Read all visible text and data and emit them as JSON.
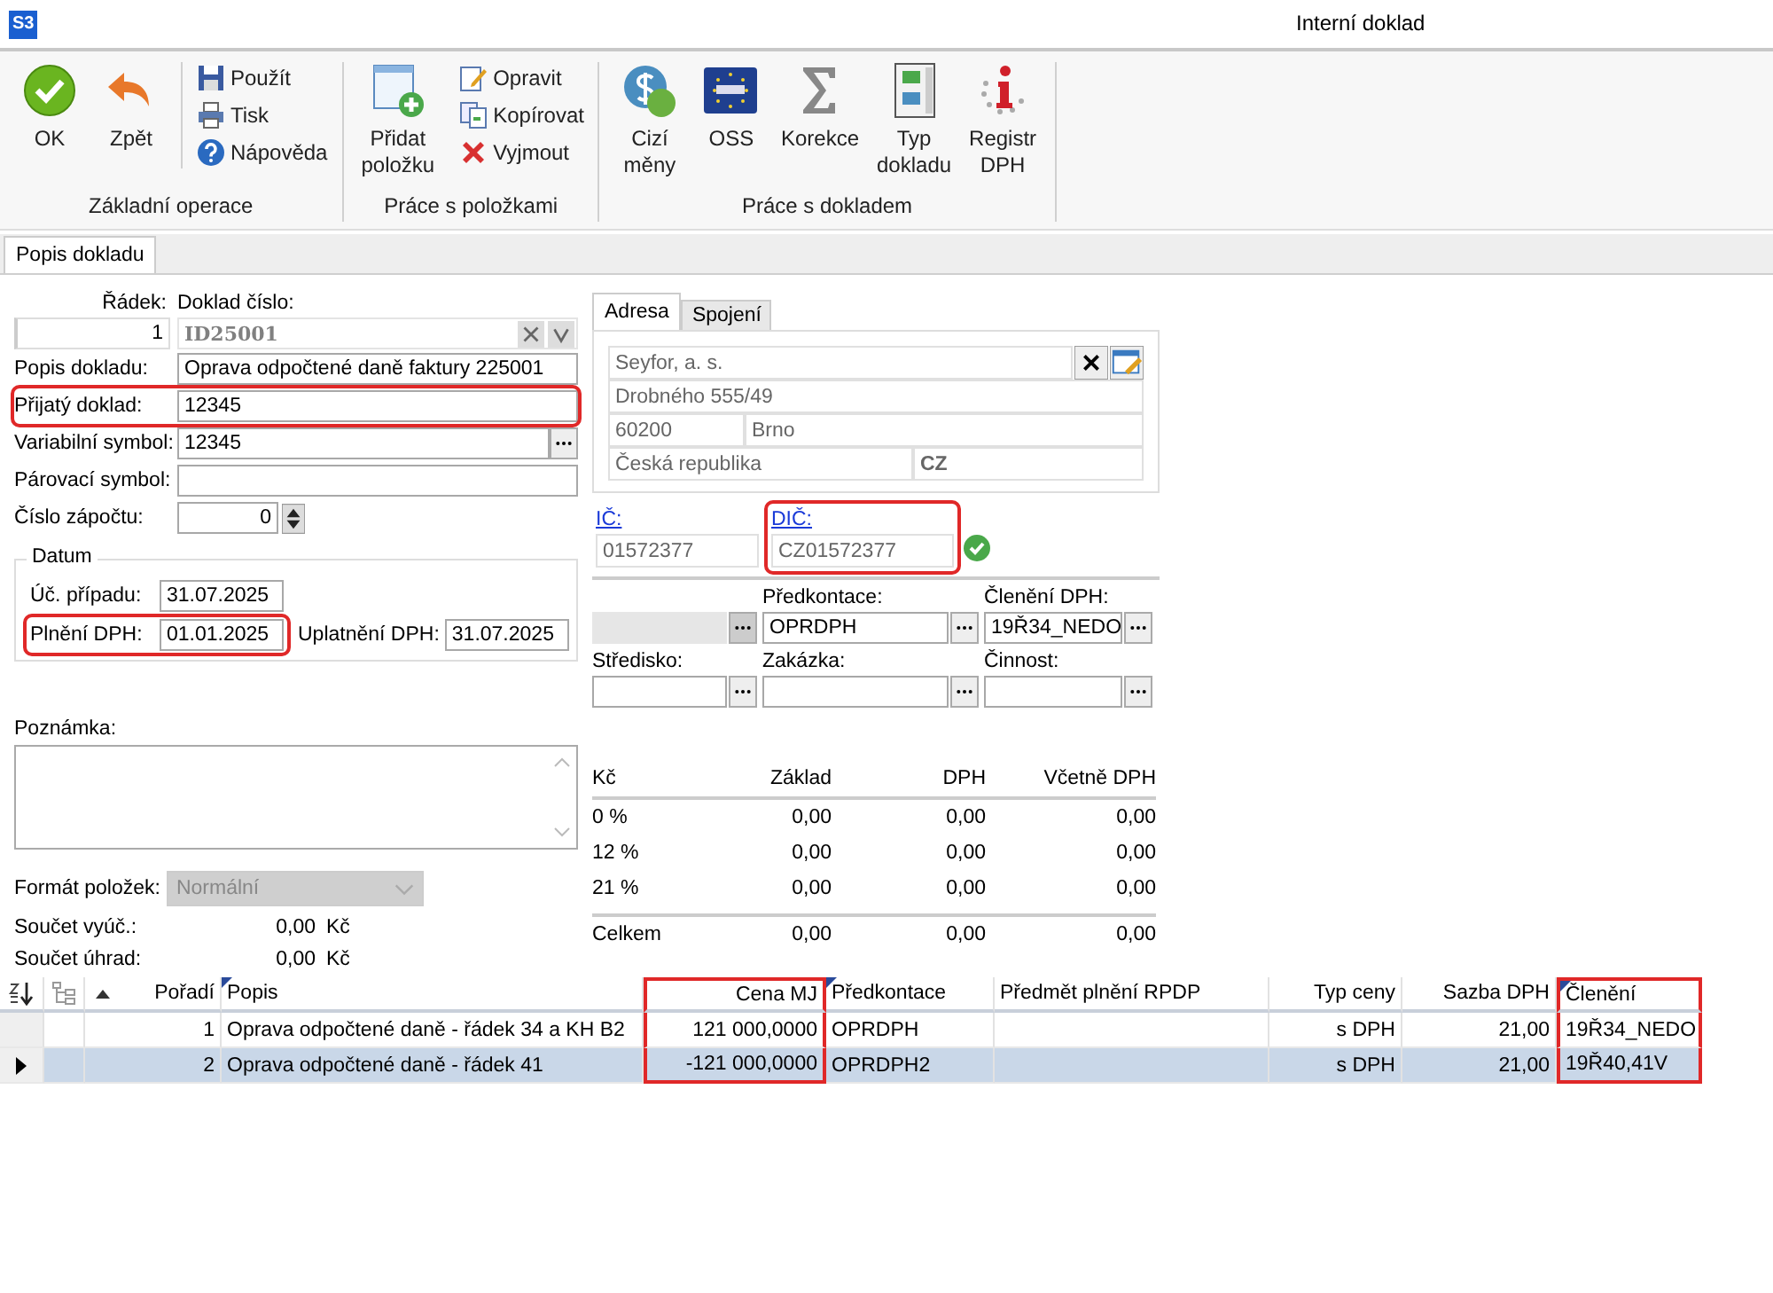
{
  "window": {
    "logo": "S3",
    "title": "Interní doklad"
  },
  "ribbon": {
    "groups": [
      {
        "label": "Základní operace",
        "large": [
          {
            "lines": [
              "OK"
            ]
          },
          {
            "lines": [
              "Zpět"
            ]
          }
        ],
        "small": [
          {
            "label": "Použít"
          },
          {
            "label": "Tisk"
          },
          {
            "label": "Nápověda"
          }
        ]
      },
      {
        "label": "Práce s položkami",
        "large": [
          {
            "lines": [
              "Přidat",
              "položku"
            ]
          }
        ],
        "small": [
          {
            "label": "Opravit"
          },
          {
            "label": "Kopírovat"
          },
          {
            "label": "Vyjmout"
          }
        ]
      },
      {
        "label": "Práce s dokladem",
        "large": [
          {
            "lines": [
              "Cizí",
              "měny"
            ]
          },
          {
            "lines": [
              "OSS"
            ]
          },
          {
            "lines": [
              "Korekce"
            ]
          },
          {
            "lines": [
              "Typ",
              "dokladu"
            ]
          },
          {
            "lines": [
              "Registr",
              "DPH"
            ]
          }
        ]
      }
    ]
  },
  "tabs": [
    {
      "label": "Popis dokladu",
      "selected": true
    }
  ],
  "doc": {
    "row_label": "Řádek:",
    "row_value": "1",
    "number_label": "Doklad číslo:",
    "number_value": "ID25001"
  },
  "fields": [
    {
      "label": "Popis dokladu:",
      "value": "Oprava odpočtené daně faktury 225001",
      "kind": "text",
      "highlighted": false
    },
    {
      "label": "Přijatý doklad:",
      "value": "12345",
      "kind": "text",
      "highlighted": true
    },
    {
      "label": "Variabilní symbol:",
      "value": "12345",
      "kind": "picker",
      "highlighted": false
    },
    {
      "label": "Párovací symbol:",
      "kind": "text",
      "highlighted": false
    },
    {
      "label": "Číslo zápočtu:",
      "value": "0",
      "kind": "spin",
      "highlighted": false
    }
  ],
  "dates": {
    "title": "Datum",
    "items": [
      {
        "label": "Úč. případu:",
        "value": "31.07.2025",
        "highlighted": false
      },
      {
        "label": "Plnění DPH:",
        "value": "01.01.2025",
        "highlighted": true
      },
      {
        "label": "Uplatnění DPH:",
        "value": "31.07.2025",
        "highlighted": false
      }
    ]
  },
  "note": {
    "label": "Poznámka:"
  },
  "format": {
    "label": "Formát položek:",
    "value": "Normální",
    "disabled": true
  },
  "totals": [
    {
      "label": "Součet vyúč.:",
      "value": "0,00",
      "currency": "Kč"
    },
    {
      "label": "Součet úhrad:",
      "value": "0,00",
      "currency": "Kč"
    }
  ],
  "partner_tabs": [
    {
      "label": "Adresa",
      "selected": true
    },
    {
      "label": "Spojení",
      "selected": false
    }
  ],
  "address": {
    "name": "Seyfor, a. s.",
    "street": "Drobného 555/49",
    "zip": "60200",
    "city": "Brno",
    "country": "Česká republika",
    "country_code": "CZ"
  },
  "ids": [
    {
      "label": "IČ:",
      "value": "01572377",
      "highlighted": false,
      "verified": false
    },
    {
      "label": "DIČ:",
      "value": "CZ01572377",
      "highlighted": true,
      "verified": true
    }
  ],
  "posting_rows": [
    [
      {
        "disabled": true
      },
      {
        "label": "Předkontace:",
        "value": "OPRDPH",
        "disabled": false
      },
      {
        "label": "Členění DPH:",
        "value": "19Ř34_NEDO",
        "disabled": false
      }
    ],
    [
      {
        "label": "Středisko:",
        "disabled": false
      },
      {
        "label": "Zakázka:",
        "disabled": false
      },
      {
        "label": "Činnost:",
        "disabled": false
      }
    ]
  ],
  "vat_table": {
    "columns": [
      "Kč",
      "Základ",
      "DPH",
      "Včetně DPH"
    ],
    "rows": [
      [
        "0 %",
        "0,00",
        "0,00",
        "0,00"
      ],
      [
        "12 %",
        "0,00",
        "0,00",
        "0,00"
      ],
      [
        "21 %",
        "0,00",
        "0,00",
        "0,00"
      ]
    ],
    "total": [
      "Celkem",
      "0,00",
      "0,00",
      "0,00"
    ]
  },
  "items_grid": {
    "columns": [
      {
        "label": "Pořadí",
        "flagged": false,
        "highlighted": false
      },
      {
        "label": "Popis",
        "flagged": true,
        "highlighted": false
      },
      {
        "label": "Cena MJ",
        "flagged": false,
        "highlighted": true
      },
      {
        "label": "Předkontace",
        "flagged": true,
        "highlighted": false
      },
      {
        "label": "Předmět plnění RPDP",
        "flagged": false,
        "highlighted": false
      },
      {
        "label": "Typ ceny",
        "flagged": false,
        "highlighted": false
      },
      {
        "label": "Sazba DPH",
        "flagged": false,
        "highlighted": false
      },
      {
        "label": "Členění",
        "flagged": true,
        "highlighted": true
      }
    ],
    "rows": [
      {
        "selected": false,
        "cells": [
          "1",
          "Oprava odpočtené daně - řádek 34 a KH B2",
          "121 000,0000",
          "OPRDPH",
          null,
          "s DPH",
          "21,00",
          "19Ř34_NEDO"
        ]
      },
      {
        "selected": true,
        "cells": [
          "2",
          "Oprava odpočtené daně - řádek 41",
          "-121 000,0000",
          "OPRDPH2",
          null,
          "s DPH",
          "21,00",
          "19Ř40,41V"
        ]
      }
    ]
  }
}
